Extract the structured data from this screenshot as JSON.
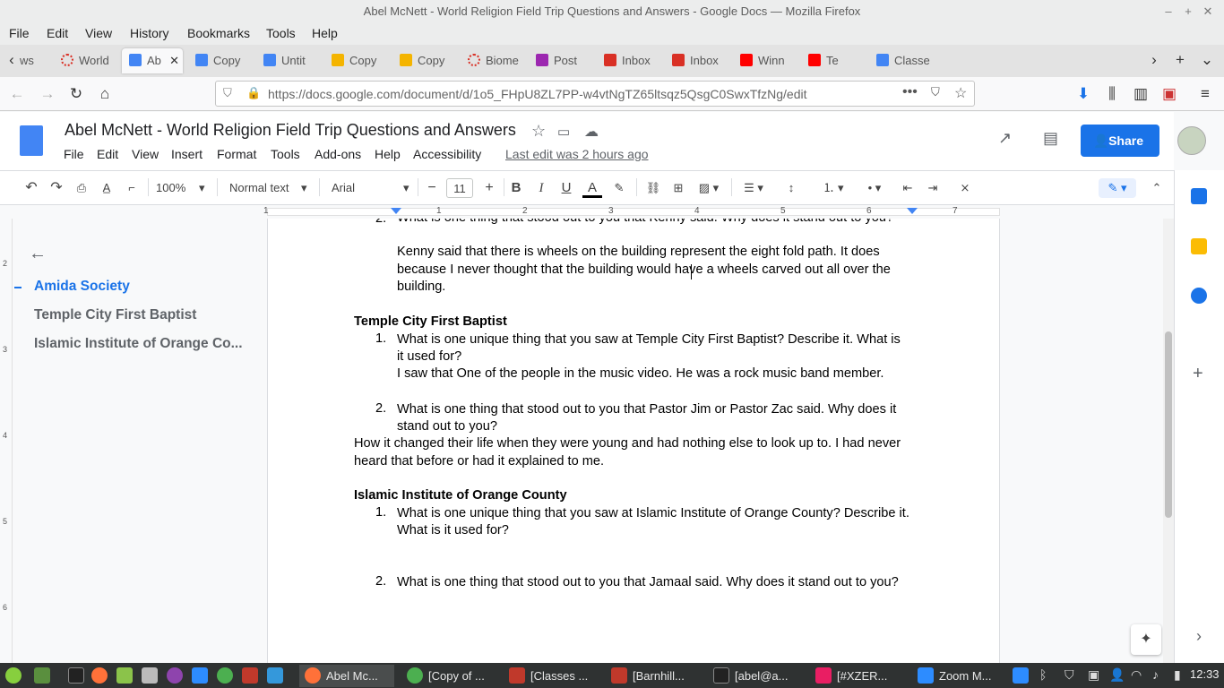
{
  "window": {
    "title": "Abel McNett - World Religion Field Trip Questions and Answers - Google Docs — Mozilla Firefox"
  },
  "firefox_menu": [
    "File",
    "Edit",
    "View",
    "History",
    "Bookmarks",
    "Tools",
    "Help"
  ],
  "tabs": [
    {
      "label": "ws",
      "color": "#888"
    },
    {
      "label": "World",
      "color": "#d93025"
    },
    {
      "label": "Ab",
      "color": "#4285f4"
    },
    {
      "label": "Copy",
      "color": "#4285f4"
    },
    {
      "label": "Untit",
      "color": "#4285f4"
    },
    {
      "label": "Copy",
      "color": "#f4b400"
    },
    {
      "label": "Copy",
      "color": "#f4b400"
    },
    {
      "label": "Biome",
      "color": "#d93025"
    },
    {
      "label": "Post",
      "color": "#9c27b0"
    },
    {
      "label": "Inbox",
      "color": "#d93025"
    },
    {
      "label": "Inbox",
      "color": "#d93025"
    },
    {
      "label": "Winn",
      "color": "#ff0000"
    },
    {
      "label": "Te",
      "color": "#ff0000"
    },
    {
      "label": "Classe",
      "color": "#4285f4"
    }
  ],
  "url": "https://docs.google.com/document/d/1o5_FHpU8ZL7PP-w4vtNgTZ65ltsqz5QsgC0SwxTfzNg/edit",
  "doc": {
    "title": "Abel McNett - World Religion Field Trip Questions and Answers",
    "menu": [
      "File",
      "Edit",
      "View",
      "Insert",
      "Format",
      "Tools",
      "Add-ons",
      "Help",
      "Accessibility"
    ],
    "last_edit": "Last edit was 2 hours ago",
    "share_label": "Share"
  },
  "toolbar": {
    "zoom": "100%",
    "style": "Normal text",
    "font": "Arial",
    "size": "11"
  },
  "ruler_numbers": [
    "1",
    "1",
    "2",
    "3",
    "4",
    "5",
    "6",
    "7"
  ],
  "vruler_numbers": [
    "2",
    "3",
    "4",
    "5",
    "6"
  ],
  "outline": {
    "items": [
      "Amida Society",
      "Temple City First Baptist",
      "Islamic Institute of Orange Co..."
    ]
  },
  "content": {
    "q2_cut": "What is one thing that stood out to you that Kenny said. Why does it stand out to you?",
    "a_kenny_1": "Kenny said that there is wheels on the building  represent the eight fold path. It does",
    "a_kenny_2": "because I never thought that the building would have a wheels carved out all over the",
    "a_kenny_3": "building.",
    "h_temple": "Temple City First Baptist",
    "t_q1_1": "What is one unique thing that you saw at Temple City First Baptist? Describe it. What is",
    "t_q1_2": "it used for?",
    "t_a1": "I saw that One of the people in the music video. He was a rock music band member.",
    "t_q2_1": "What is one thing that stood out to you that Pastor Jim or Pastor Zac said. Why does it",
    "t_q2_2": "stand out to you?",
    "t_a2_1": "How it changed their life when they were young and had nothing else to look up to. I had never",
    "t_a2_2": "heard that before or had it explained to me.",
    "h_islamic": "Islamic Institute of Orange County",
    "i_q1_1": "What is one unique thing that you saw at Islamic Institute of Orange County? Describe it.",
    "i_q1_2": "What is it used for?",
    "i_q2": "What is one thing that stood out to you that Jamaal said. Why does it stand out to you?",
    "n1": "1.",
    "n2": "2."
  },
  "taskbar": {
    "items": [
      "Abel Mc...",
      "[Copy of ...",
      "[Classes ...",
      "[Barnhill...",
      "[abel@a...",
      "[#XZER...",
      "Zoom M..."
    ],
    "clock": "12:33"
  }
}
